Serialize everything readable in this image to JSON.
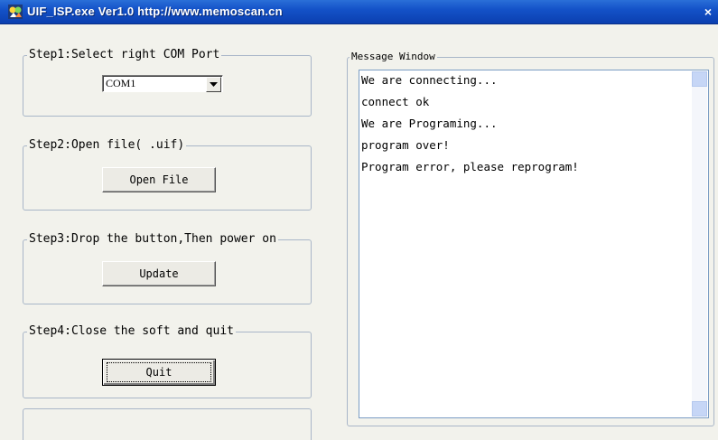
{
  "window": {
    "title": "UIF_ISP.exe  Ver1.0  http://www.memoscan.cn",
    "icon": "app-icon",
    "close_symbol": "×",
    "titlebar_color": "#1452c8"
  },
  "steps": {
    "step1": {
      "legend": "Step1:Select right COM Port",
      "com_value": "COM1"
    },
    "step2": {
      "legend": "Step2:Open file( .uif)",
      "button": "Open File"
    },
    "step3": {
      "legend": "Step3:Drop the button,Then power on",
      "button": "Update"
    },
    "step4": {
      "legend": "Step4:Close the soft and quit",
      "button": "Quit"
    }
  },
  "message_window": {
    "legend": "Message Window",
    "messages": [
      "We are connecting...",
      "connect ok",
      "We are Programing...",
      "program over!",
      "Program error, please reprogram!"
    ]
  }
}
